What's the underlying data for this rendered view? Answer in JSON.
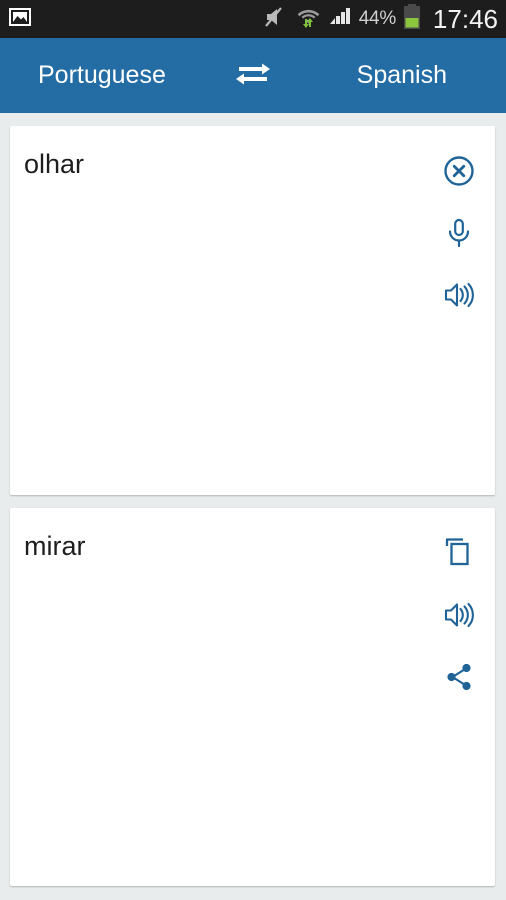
{
  "statusbar": {
    "notification_icon": "image-photo-icon",
    "icons": [
      {
        "name": "volume-muted-icon"
      },
      {
        "name": "wifi-transfer-icon"
      },
      {
        "name": "cellular-signal-icon"
      }
    ],
    "battery_percent": "44%",
    "battery_icon": "battery-icon",
    "clock": "17:46",
    "colors": {
      "background": "#1d1d1d",
      "text": "#f2f2f2",
      "battery_fill": "#8cc63e"
    }
  },
  "actionbar": {
    "source_language": "Portuguese",
    "target_language": "Spanish",
    "swap_icon": "swap-arrows-icon",
    "colors": {
      "background": "#236ca4",
      "text": "#ffffff"
    }
  },
  "source_card": {
    "name": "source-text-card",
    "text": "olhar",
    "actions": [
      {
        "name": "clear-icon",
        "label": "Clear"
      },
      {
        "name": "microphone-icon",
        "label": "Voice input"
      },
      {
        "name": "speaker-icon",
        "label": "Listen"
      }
    ]
  },
  "target_card": {
    "name": "translation-result-card",
    "text": "mirar",
    "actions": [
      {
        "name": "copy-icon",
        "label": "Copy"
      },
      {
        "name": "speaker-icon",
        "label": "Listen"
      },
      {
        "name": "share-icon",
        "label": "Share"
      }
    ]
  },
  "theme": {
    "accent": "#236ca4",
    "icon_color": "#1f6397",
    "page_background": "#e8ecec",
    "card_background": "#ffffff",
    "card_text": "#1e1e1e"
  }
}
